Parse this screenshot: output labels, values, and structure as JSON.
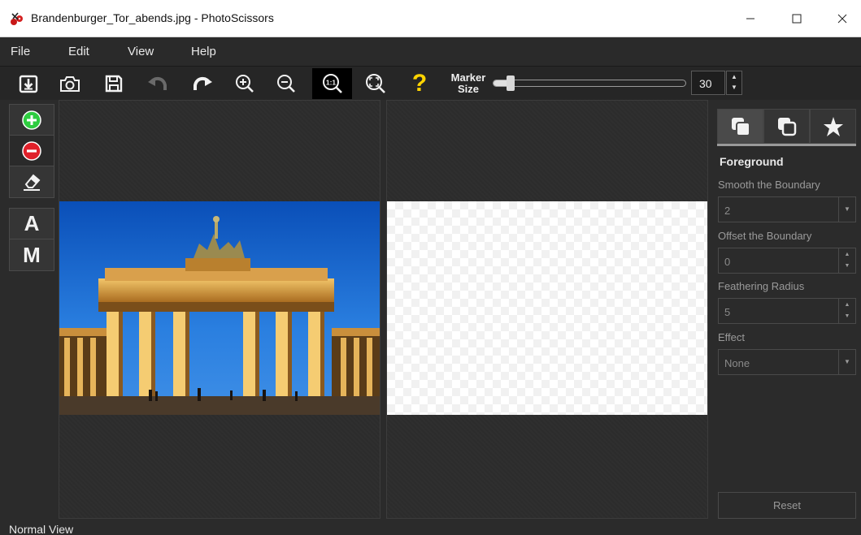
{
  "window": {
    "title": "Brandenburger_Tor_abends.jpg - PhotoScissors",
    "app_icon": "photoscissors-logo"
  },
  "menu": [
    {
      "label": "File"
    },
    {
      "label": "Edit"
    },
    {
      "label": "View"
    },
    {
      "label": "Help"
    }
  ],
  "toolbar": {
    "buttons": [
      "open-icon",
      "camera-icon",
      "save-icon",
      "undo-icon",
      "redo-icon",
      "zoom-in-icon",
      "zoom-out-icon",
      "zoom-actual-icon",
      "zoom-fit-icon",
      "help-icon"
    ],
    "active_button": "zoom-actual-icon",
    "marker_size_label": "Marker Size",
    "marker_size_value": "30",
    "marker_size_fraction": 0.09
  },
  "tools": {
    "markers": [
      "add-foreground-icon",
      "remove-background-icon",
      "eraser-icon"
    ],
    "mode_letters": [
      "A",
      "M"
    ]
  },
  "right_panel": {
    "tabs": [
      "foreground-tab-icon",
      "background-tab-icon",
      "effects-tab-icon"
    ],
    "heading": "Foreground",
    "smooth_label": "Smooth the Boundary",
    "smooth_value": "2",
    "offset_label": "Offset the Boundary",
    "offset_value": "0",
    "feather_label": "Feathering Radius",
    "feather_value": "5",
    "effect_label": "Effect",
    "effect_value": "None",
    "reset_label": "Reset"
  },
  "status": {
    "text": "Normal View"
  },
  "colors": {
    "accent_add": "#2ecc40",
    "accent_remove": "#e0202a",
    "help_yellow": "#ffd400"
  }
}
